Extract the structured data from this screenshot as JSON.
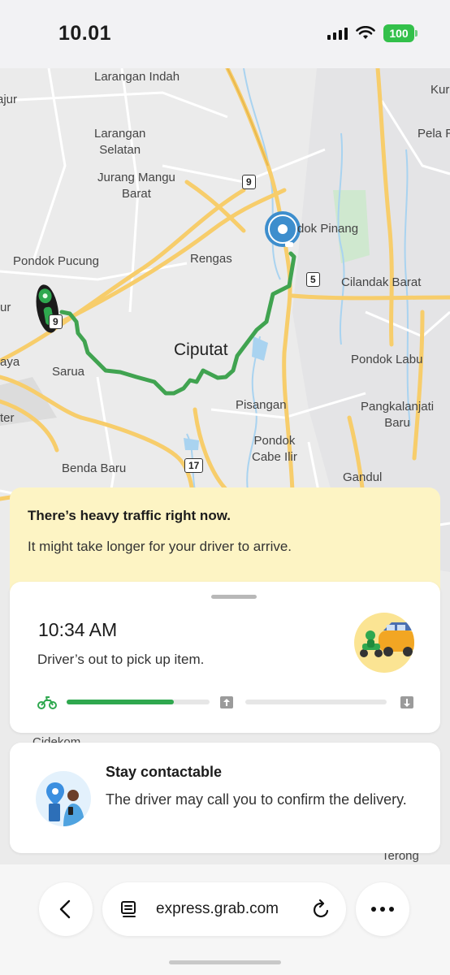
{
  "status_bar": {
    "time": "10.01",
    "battery": "100"
  },
  "map": {
    "labels": [
      "Larangan Indah",
      "Larangan\nSelatan",
      "Jurang Mangu\nBarat",
      "Pondok Pucung",
      "Rengas",
      "Ciputat",
      "Sarua",
      "Benda Baru",
      "Pisangan",
      "Pondok\nCabe Ilir",
      "Gandul",
      "Pondok Labu",
      "Pangkalanjati\nBaru",
      "Cilandak Barat",
      "dok Pinang",
      "Pela R",
      "Kur",
      "ajur",
      "ur",
      "aya",
      "ter",
      "Cidekom",
      "Terong"
    ],
    "road_shields": [
      "9",
      "5",
      "9",
      "17"
    ]
  },
  "traffic_banner": {
    "title": "There’s heavy traffic right now.",
    "body": "It might take longer for your driver to arrive."
  },
  "delivery_status": {
    "eta": "10:34 AM",
    "description": "Driver’s out to pick up item.",
    "progress": 0.75,
    "accent_color": "#2fa84f"
  },
  "contact_card": {
    "title": "Stay contactable",
    "body": "The driver may call you to confirm the delivery."
  },
  "browser_bar": {
    "url": "express.grab.com"
  },
  "icons": [
    "back-icon",
    "reader-icon",
    "reload-icon",
    "more-icon",
    "motorbike-icon",
    "pickup-box-icon",
    "dropoff-box-icon",
    "location-pin-icon"
  ]
}
